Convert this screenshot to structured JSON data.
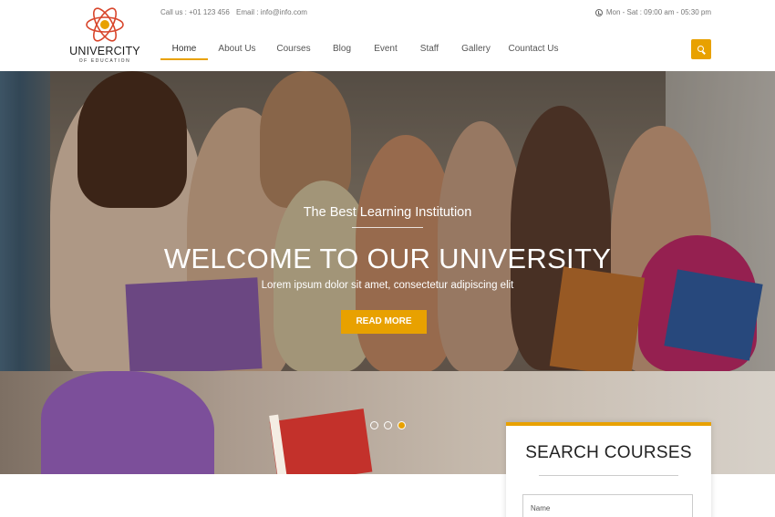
{
  "header": {
    "logo": {
      "name": "UNIVERCITY",
      "tagline": "OF EDUCATION",
      "icon": "atom-icon"
    },
    "call": "Call us : +01 123 456",
    "email": "Email : info@info.com",
    "hours": "Mon - Sat : 09:00 am - 05:30 pm",
    "hours_icon": "clock-icon",
    "nav": [
      {
        "label": "Home",
        "active": true
      },
      {
        "label": "About Us",
        "active": false
      },
      {
        "label": "Courses",
        "active": false
      },
      {
        "label": "Blog",
        "active": false
      },
      {
        "label": "Event",
        "active": false
      },
      {
        "label": "Staff",
        "active": false
      },
      {
        "label": "Gallery",
        "active": false
      },
      {
        "label": "Countact Us",
        "active": false
      }
    ],
    "search_icon": "search-icon"
  },
  "hero": {
    "tagline": "The Best Learning Institution",
    "headline": "WELCOME TO OUR UNIVERSITY",
    "subtext": "Lorem ipsum dolor sit amet, consectetur adipiscing elit",
    "button": "READ MORE",
    "slides": 3,
    "active_slide": 3
  },
  "search_courses": {
    "title": "SEARCH COURSES",
    "name_placeholder": "Name"
  },
  "colors": {
    "accent": "#e8a100",
    "logo_red": "#d8452b"
  }
}
